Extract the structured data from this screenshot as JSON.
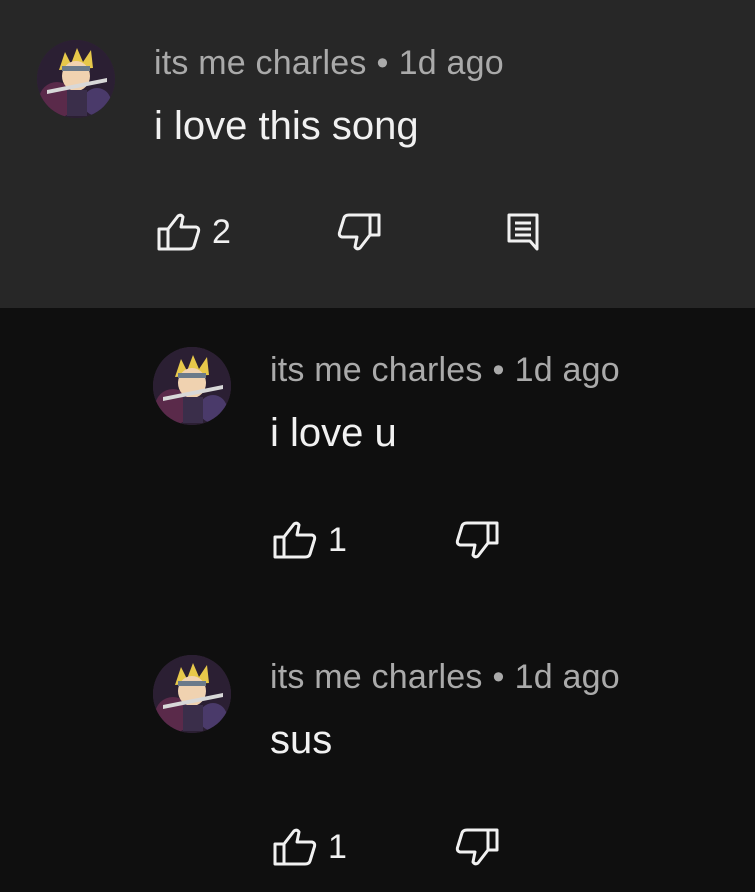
{
  "comments": [
    {
      "author": "its me charles",
      "separator": "•",
      "time": "1d ago",
      "text": "i love this song",
      "likes": "2",
      "avatar_icon": "anime-avatar",
      "has_reply_button": true
    },
    {
      "author": "its me charles",
      "separator": "•",
      "time": "1d ago",
      "text": "i love u",
      "likes": "1",
      "avatar_icon": "anime-avatar",
      "has_reply_button": false
    },
    {
      "author": "its me charles",
      "separator": "•",
      "time": "1d ago",
      "text": "sus",
      "likes": "1",
      "avatar_icon": "anime-avatar",
      "has_reply_button": false
    }
  ],
  "colors": {
    "top_background": "#272727",
    "background": "#0f0f0f",
    "meta_text": "#aaaaaa",
    "primary_text": "#f1f1f1"
  }
}
